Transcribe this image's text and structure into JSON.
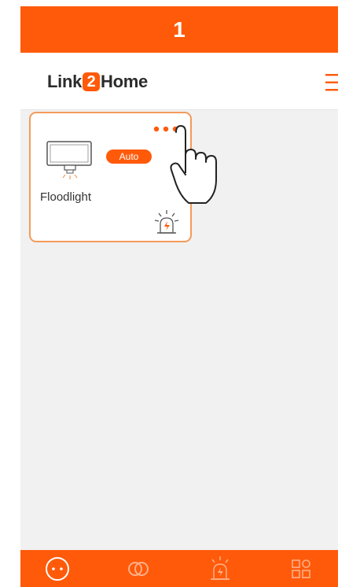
{
  "step_number": "1",
  "app": {
    "logo_prefix": "Link",
    "logo_digit": "2",
    "logo_suffix": "Home"
  },
  "colors": {
    "accent": "#ff5a0a",
    "card_border": "#f49a5a",
    "background": "#f1f1f1"
  },
  "device": {
    "name": "Floodlight",
    "mode_badge": "Auto",
    "icon": "floodlight-icon",
    "status_icon": "alarm-siren-icon",
    "more_icon": "more-dots-icon"
  },
  "header": {
    "menu_icon": "hamburger-menu-icon"
  },
  "bottom_nav": [
    {
      "icon": "socket-icon",
      "active": true
    },
    {
      "icon": "link-icon",
      "active": false
    },
    {
      "icon": "alarm-siren-icon",
      "active": false
    },
    {
      "icon": "grid-apps-icon",
      "active": false
    }
  ]
}
